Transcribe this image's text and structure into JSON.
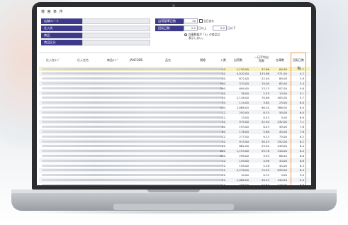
{
  "search_panel": {
    "title": "検 索 条 件",
    "labels": {
      "store_code": "店舗コード",
      "supplier": "仕入先",
      "product": "商品",
      "product_category": "商品区分",
      "order_base_days": "出荷基準日数",
      "rotation_days": "回転日数"
    },
    "order_base_days_value": "30",
    "day_checkbox_label": "当日含む",
    "rotation_min": "0.0",
    "rotation_min_suffix": "日以上",
    "rotation_max": "0.0",
    "rotation_max_suffix": "日以下",
    "radio_label_line1": "在庫数量が「0」の商品は",
    "radio_label_line2": "表示しない。"
  },
  "table": {
    "headers": {
      "supplier_code": "仕入先ｺｰﾄﾞ",
      "supplier_name": "仕入先名",
      "product_code": "商品ｺｰﾄﾞ",
      "jancode": "JANCODE",
      "product_name": "品名",
      "spec": "規格",
      "qty": "入数",
      "shipped": "出荷数",
      "avg_shipped_l1": "一日平均出",
      "avg_shipped_l2": "荷数",
      "stock": "在庫数",
      "rotation_days": "回転日数"
    },
    "rows": [
      {
        "qty": "10",
        "shipped": "1,130.00",
        "avg": "37.66",
        "stock": "64.00",
        "rot": "1.7"
      },
      {
        "qty": "20",
        "shipped": "4,010.00",
        "avg": "133.66",
        "stock": "571.00",
        "rot": "4.2"
      },
      {
        "qty": "40",
        "shipped": "672.00",
        "avg": "22.40",
        "stock": "89.00",
        "rot": "3.9"
      },
      {
        "qty": "100",
        "shipped": "570.00",
        "avg": "19.00",
        "stock": "65.00",
        "rot": "3.4"
      },
      {
        "qty": "200",
        "shipped": "694.00",
        "avg": "23.13",
        "stock": "107.00",
        "rot": "4.6"
      },
      {
        "qty": "40",
        "shipped": "76.00",
        "avg": "2.53",
        "stock": "13.00",
        "rot": "5.1"
      },
      {
        "qty": "20",
        "shipped": "2,126.00",
        "avg": "70.86",
        "stock": "405.00",
        "rot": "5.7"
      },
      {
        "qty": "50",
        "shipped": "114.00",
        "avg": "3.80",
        "stock": "23.00",
        "rot": "6.0"
      },
      {
        "qty": "100",
        "shipped": "2,886.00",
        "avg": "96.20",
        "stock": "586.00",
        "rot": "6.0"
      },
      {
        "qty": "12",
        "shipped": "250.00",
        "avg": "8.33",
        "stock": "50.00",
        "rot": "6.0"
      },
      {
        "qty": "12",
        "shipped": "13.00",
        "avg": "0.43",
        "stock": "3.00",
        "rot": "6.9"
      },
      {
        "qty": "20",
        "shipped": "975.00",
        "avg": "32.50",
        "stock": "232.00",
        "rot": "7.1"
      },
      {
        "qty": "60",
        "shipped": "193.00",
        "avg": "6.43",
        "stock": "49.00",
        "rot": "7.6"
      },
      {
        "qty": "60",
        "shipped": "176.00",
        "avg": "5.86",
        "stock": "45.00",
        "rot": "7.6"
      },
      {
        "qty": "12",
        "shipped": "277.00",
        "avg": "9.23",
        "stock": "73.00",
        "rot": "8.2"
      },
      {
        "qty": "20",
        "shipped": "913.00",
        "avg": "30.43",
        "stock": "252.00",
        "rot": "8.2"
      },
      {
        "qty": "20",
        "shipped": "882.00",
        "avg": "29.40",
        "stock": "249.00",
        "rot": "8.4"
      },
      {
        "qty": "200",
        "shipped": "1,193.00",
        "avg": "39.76",
        "stock": "310.00",
        "rot": "8.4"
      },
      {
        "qty": "200",
        "shipped": "298.00",
        "avg": "9.93",
        "stock": "86.00",
        "rot": "8.6"
      },
      {
        "qty": "10",
        "shipped": "149.00",
        "avg": "4.96",
        "stock": "43.00",
        "rot": "8.6"
      },
      {
        "qty": "70",
        "shipped": "158.00",
        "avg": "5.26",
        "stock": "44.00",
        "rot": "8.3"
      },
      {
        "qty": "12",
        "shipped": "2,278.00",
        "avg": "75.93",
        "stock": "639.00",
        "rot": "8.4"
      },
      {
        "qty": "20",
        "shipped": "10.00",
        "avg": "0.33",
        "stock": "3.00",
        "rot": "9.0"
      },
      {
        "qty": "50",
        "shipped": "1,086.00",
        "avg": "36.53",
        "stock": "344.00",
        "rot": "9.4"
      },
      {
        "qty": "25",
        "shipped": "738.00",
        "avg": "24.62",
        "stock": "216.00",
        "rot": "8.8"
      }
    ]
  },
  "colors": {
    "label_bg": "#3d3a8c",
    "highlight": "#e79a4a",
    "selected_row": "#f7f1c2"
  },
  "icons": {
    "sort": "gear-icon"
  }
}
